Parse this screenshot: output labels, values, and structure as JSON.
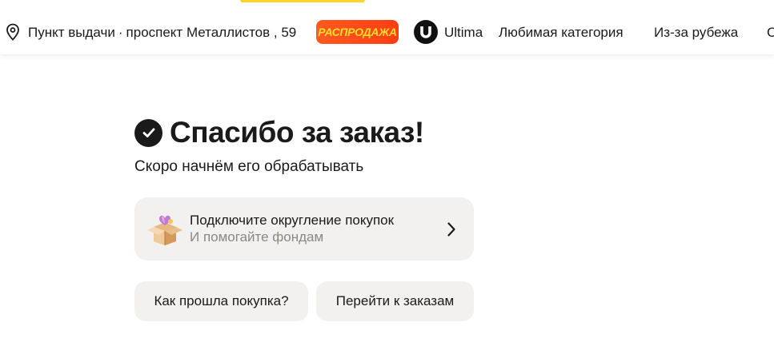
{
  "header": {
    "pickup_label": "Пункт выдачи",
    "pickup_separator": "·",
    "pickup_address": "проспект Металлистов , 59",
    "sale_badge": "РАСПРОДАЖА",
    "ultima_logo_letter": "U",
    "ultima_label": "Ultima",
    "nav_links": [
      "Любимая категория",
      "Из-за рубежа",
      "С"
    ]
  },
  "main": {
    "title": "Спасибо за заказ!",
    "subtitle": "Скоро начнём его обрабатывать",
    "promo": {
      "title": "Подключите округление покупок",
      "subtitle": "И помогайте фондам"
    },
    "buttons": {
      "review": "Как прошла покупка?",
      "orders": "Перейти к заказам"
    }
  },
  "colors": {
    "accent_yellow": "#fed42b",
    "sale_red": "#ff3d12",
    "sale_text": "#ffdd2d",
    "card_bg": "#f2f1ef",
    "text_primary": "#1a1a1a",
    "text_secondary": "#8a8784"
  },
  "icons": {
    "location": "location-pin-icon",
    "ultima": "ultima-logo-icon",
    "check": "check-circle-icon",
    "promo": "gift-box-icon",
    "chevron": "chevron-right-icon"
  }
}
